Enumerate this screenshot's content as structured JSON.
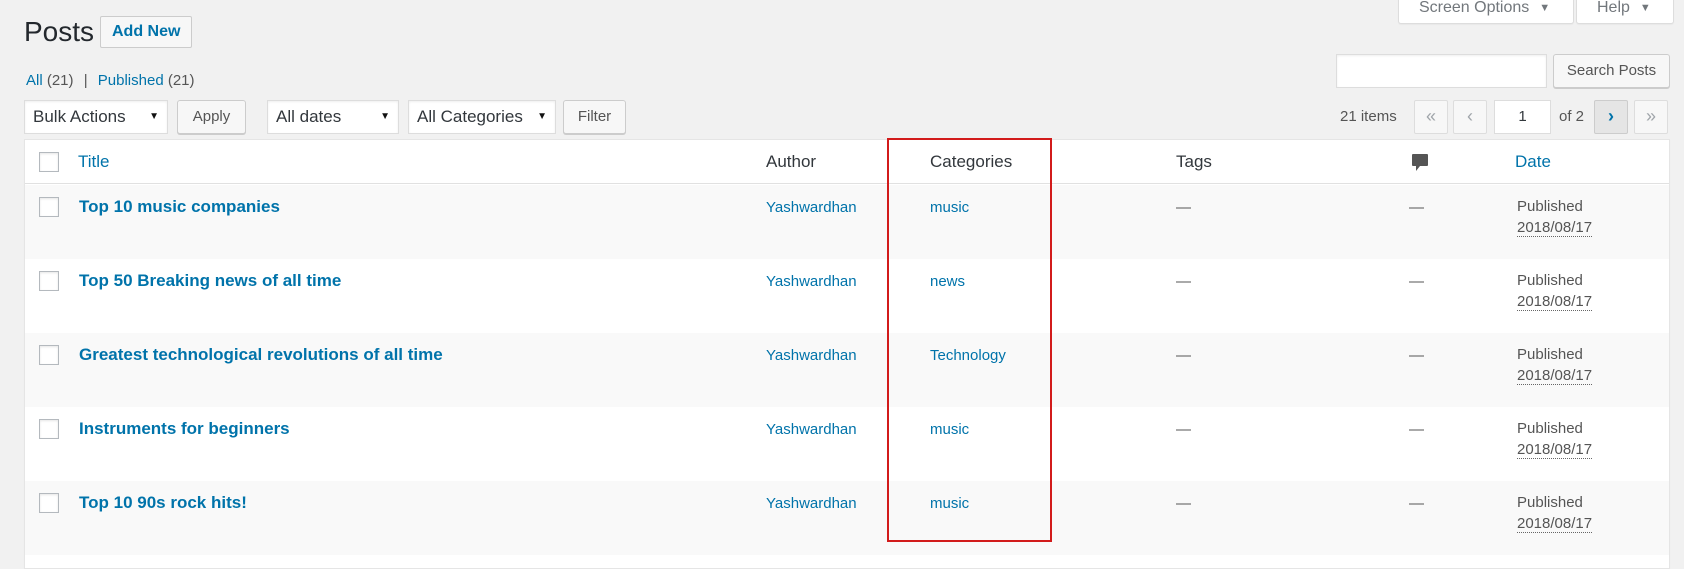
{
  "header": {
    "screen_options_label": "Screen Options",
    "help_label": "Help",
    "page_title": "Posts",
    "add_new_label": "Add New"
  },
  "filters": {
    "all_label": "All",
    "all_count": "(21)",
    "separator": "|",
    "published_label": "Published",
    "published_count": "(21)"
  },
  "search": {
    "value": "",
    "button_label": "Search Posts"
  },
  "tablenav": {
    "bulk_actions": "Bulk Actions",
    "apply_label": "Apply",
    "dates": "All dates",
    "categories": "All Categories",
    "filter_label": "Filter",
    "items_count": "21 items",
    "first_page": "«",
    "prev_page": "‹",
    "current_page": "1",
    "of_total": "of 2",
    "next_page": "›",
    "last_page": "»"
  },
  "table": {
    "headers": {
      "title": "Title",
      "author": "Author",
      "categories": "Categories",
      "tags": "Tags",
      "comments_icon": "comment-bubble-icon",
      "date": "Date"
    },
    "rows": [
      {
        "title": "Top 10 music companies",
        "author": "Yashwardhan",
        "category": "music",
        "tags": "—",
        "comments": "—",
        "status": "Published",
        "date": "2018/08/17"
      },
      {
        "title": "Top 50 Breaking news of all time",
        "author": "Yashwardhan",
        "category": "news",
        "tags": "—",
        "comments": "—",
        "status": "Published",
        "date": "2018/08/17"
      },
      {
        "title": "Greatest technological revolutions of all time",
        "author": "Yashwardhan",
        "category": "Technology",
        "tags": "—",
        "comments": "—",
        "status": "Published",
        "date": "2018/08/17"
      },
      {
        "title": "Instruments for beginners",
        "author": "Yashwardhan",
        "category": "music",
        "tags": "—",
        "comments": "—",
        "status": "Published",
        "date": "2018/08/17"
      },
      {
        "title": "Top 10 90s rock hits!",
        "author": "Yashwardhan",
        "category": "music",
        "tags": "—",
        "comments": "—",
        "status": "Published",
        "date": "2018/08/17"
      }
    ]
  },
  "colors": {
    "link": "#0073aa",
    "highlight_box": "#d21b1b",
    "background": "#f1f1f1"
  }
}
